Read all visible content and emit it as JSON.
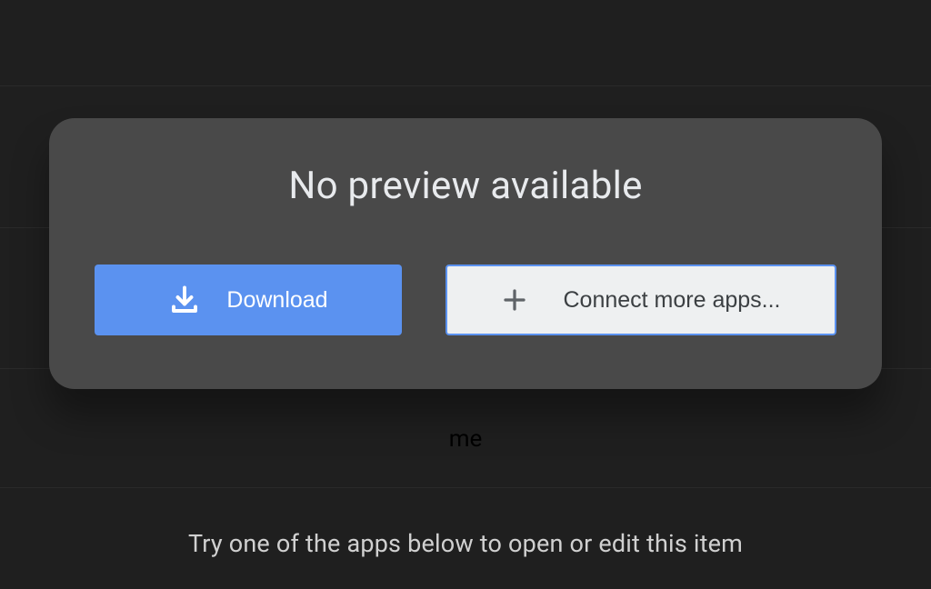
{
  "background": {
    "faint_text": "me"
  },
  "card": {
    "title": "No preview available",
    "download_label": "Download",
    "connect_label": "Connect more apps..."
  },
  "footer": {
    "hint": "Try one of the apps below to open or edit this item"
  }
}
